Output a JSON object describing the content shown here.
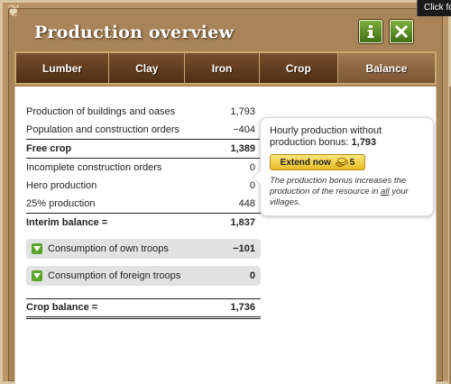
{
  "window": {
    "title": "Production overview",
    "tooltip_hint": "Click fo"
  },
  "tabs": [
    {
      "label": "Lumber",
      "active": false
    },
    {
      "label": "Clay",
      "active": false
    },
    {
      "label": "Iron",
      "active": false
    },
    {
      "label": "Crop",
      "active": false
    },
    {
      "label": "Balance",
      "active": true
    }
  ],
  "balance": {
    "rows": [
      {
        "label": "Production of buildings and oases",
        "value": "1,793"
      },
      {
        "label": "Population and construction orders",
        "value": "−404"
      },
      {
        "label": "Free crop",
        "value": "1,389"
      },
      {
        "label": "Incomplete construction orders",
        "value": "0"
      },
      {
        "label": "Hero production",
        "value": "0"
      },
      {
        "label": "25% production",
        "value": "448"
      },
      {
        "label": "Interim balance =",
        "value": "1,837"
      }
    ],
    "own_troops": {
      "label": "Consumption of own troops",
      "value": "−101"
    },
    "foreign_troops": {
      "label": "Consumption of foreign troops",
      "value": "0"
    },
    "crop_balance": {
      "label": "Crop balance =",
      "value": "1,736"
    }
  },
  "infobox": {
    "text": "Hourly production without production bonus:",
    "value": "1,793",
    "button_label": "Extend now",
    "button_cost": "5",
    "note_prefix": "The production bonus increases the production of the resource in ",
    "note_emphasis": "all",
    "note_suffix": " your villages."
  },
  "colors": {
    "accent_green": "#5aa42a",
    "gold_button": "#e7bb25",
    "tab_bg": "#5b3a1d",
    "frame": "#b89466"
  }
}
